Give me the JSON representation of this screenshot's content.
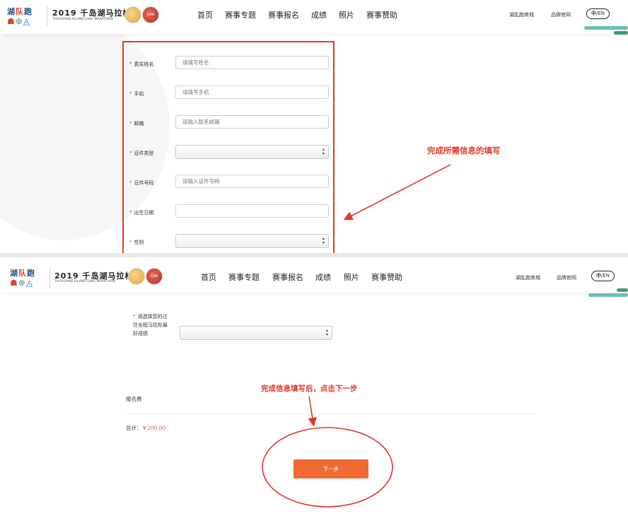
{
  "header": {
    "brand_cn": [
      "湖",
      "队",
      "跑"
    ],
    "brand_glyphs": [
      "☗",
      "⊕",
      "◬"
    ],
    "event_title": "2019 千岛湖马拉松",
    "event_sub": "THOUSAND ISLAND LAKE MARATHON",
    "badge2_text": "CAA",
    "nav": [
      "首页",
      "赛事专题",
      "赛事报名",
      "成绩",
      "照片",
      "赛事赞助"
    ],
    "right_links": [
      "湖乱跑商城",
      "品牌官网"
    ],
    "lang_cn": "中",
    "lang_en": "/EN",
    "colors": {
      "accent": "#ef6a33",
      "required": "#e0483a",
      "callout": "#e3372a",
      "deco_teal": "#6cbfb0",
      "deco_green": "#3f9e6a"
    }
  },
  "form": {
    "fields": [
      {
        "label": "真实姓名",
        "type": "text",
        "placeholder": "请填写姓名"
      },
      {
        "label": "手机",
        "type": "text",
        "placeholder": "请填写手机"
      },
      {
        "label": "邮箱",
        "type": "text",
        "placeholder": "请输入联系邮箱"
      },
      {
        "label": "证件类型",
        "type": "select",
        "value": ""
      },
      {
        "label": "证件号码",
        "type": "text",
        "placeholder": "请输入证件号码"
      },
      {
        "label": "出生日期",
        "type": "text",
        "placeholder": ""
      },
      {
        "label": "性别",
        "type": "select",
        "value": ""
      }
    ],
    "best_result_label": [
      "请选择您的过",
      "往全程马拉松最",
      "好成绩"
    ]
  },
  "annotations": {
    "fill_info": "完成所需信息的填写",
    "click_next": "完成信息填写后，点击下一步"
  },
  "fee": {
    "label": "报名费",
    "total_prefix": "总计：",
    "total_amount": "￥200.00"
  },
  "next_button": "下一步"
}
